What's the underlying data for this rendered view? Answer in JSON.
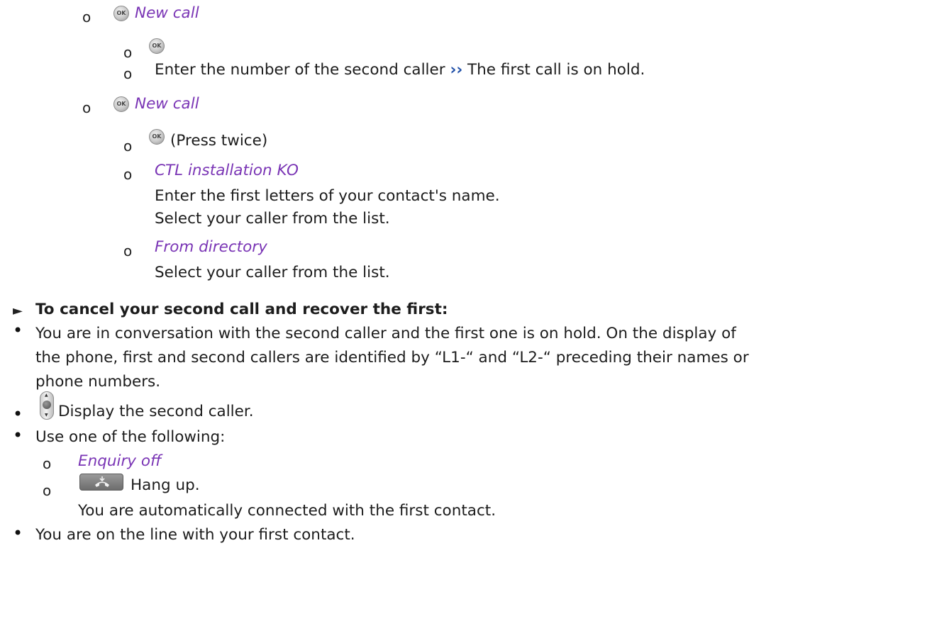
{
  "list_a": {
    "item1_label": "New call",
    "item1_step2": "Enter the number of the second caller",
    "item1_step2_after": "The first call is on hold.",
    "chevron": "››",
    "item2_label": "New call",
    "item2_step1": "(Press twice)",
    "item2_step2_label": "CTL installation KO",
    "item2_step2_line1": "Enter the first letters of your contact's name.",
    "item2_step2_line2": "Select your caller from the list.",
    "item2_step3_label": "From directory",
    "item2_step3_line1": "Select your caller from the list."
  },
  "section": {
    "arrow": "►",
    "heading": "To cancel your second call and recover the first:",
    "bullet1_line1": "You are in conversation with the second caller and the first one is on hold. On the display of",
    "bullet1_line2": "the phone, first and second callers are identified by “L1-“ and “L2-“ preceding their names or",
    "bullet1_line3": "phone numbers.",
    "bullet2": "Display the second caller.",
    "bullet3": "Use one of the following:",
    "sub1": "Enquiry off",
    "sub2": "Hang up.",
    "sub2_line2": "You are automatically connected with the first contact.",
    "bullet4": "You are on the line with your first contact."
  },
  "icons": {
    "ok": "ok-key-icon",
    "nav": "navigator-icon",
    "hangup": "hang-up-key-icon"
  }
}
